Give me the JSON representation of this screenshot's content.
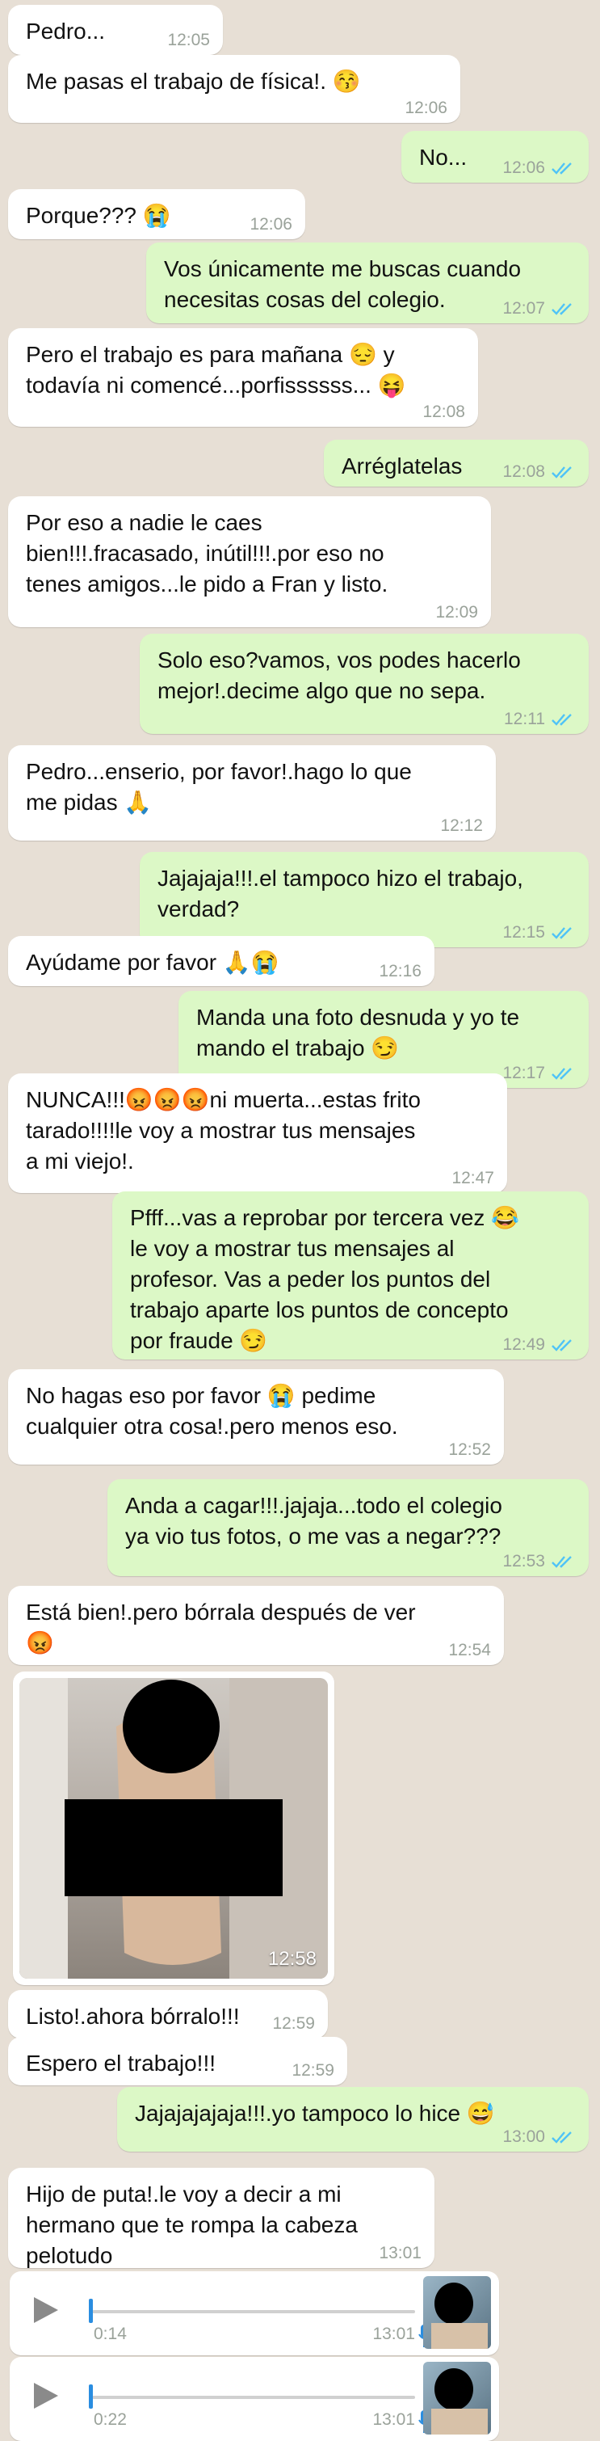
{
  "messages": [
    {
      "side": "in",
      "text": "Pedro...",
      "time": "12:05"
    },
    {
      "side": "in",
      "text": "Me pasas el trabajo de física!. 😚",
      "time": "12:06"
    },
    {
      "side": "out",
      "text": "No...",
      "time": "12:06"
    },
    {
      "side": "in",
      "text": "Porque??? 😭",
      "time": "12:06"
    },
    {
      "side": "out",
      "text": "Vos únicamente me buscas cuando\nnecesitas cosas del colegio.",
      "time": "12:07"
    },
    {
      "side": "in",
      "text": "Pero el trabajo es para mañana 😔 y\ntodavía ni comencé...porfissssss... 😝",
      "time": "12:08"
    },
    {
      "side": "out",
      "text": "Arréglatelas",
      "time": "12:08"
    },
    {
      "side": "in",
      "text": "Por eso a nadie le caes\nbien!!!.fracasado, inútil!!!.por eso no\ntenes amigos...le pido a Fran y listo.",
      "time": "12:09"
    },
    {
      "side": "out",
      "text": "Solo eso?vamos, vos podes hacerlo\nmejor!.decime algo que no sepa.",
      "time": "12:11"
    },
    {
      "side": "in",
      "text": "Pedro...enserio, por favor!.hago lo que\nme pidas 🙏",
      "time": "12:12"
    },
    {
      "side": "out",
      "text": "Jajajaja!!!.el tampoco hizo el trabajo,\nverdad?",
      "time": "12:15"
    },
    {
      "side": "in",
      "text": "Ayúdame por favor 🙏😭",
      "time": "12:16"
    },
    {
      "side": "out",
      "text": "Manda una foto desnuda y yo te\nmando el trabajo 😏",
      "time": "12:17"
    },
    {
      "side": "in",
      "text": "NUNCA!!!😡😡😡ni muerta...estas frito\ntarado!!!!le voy a mostrar tus mensajes\na mi viejo!.",
      "time": "12:47"
    },
    {
      "side": "out",
      "text": "Pfff...vas a reprobar por tercera vez 😂\nle voy a mostrar tus mensajes al\nprofesor. Vas a peder los puntos del\ntrabajo aparte los puntos de concepto\npor fraude 😏",
      "time": "12:49"
    },
    {
      "side": "in",
      "text": "No hagas eso por favor 😭 pedime\ncualquier otra cosa!.pero menos eso.",
      "time": "12:52"
    },
    {
      "side": "out",
      "text": "Anda a cagar!!!.jajaja...todo el colegio\nya vio tus fotos, o me vas a negar???",
      "time": "12:53"
    },
    {
      "side": "in",
      "text": "Está bien!.pero bórrala después de ver\n😡",
      "time": "12:54"
    },
    {
      "side": "in",
      "text": "Listo!.ahora bórralo!!!",
      "time": "12:59"
    },
    {
      "side": "in",
      "text": "Espero el trabajo!!!",
      "time": "12:59"
    },
    {
      "side": "out",
      "text": "Jajajajajaja!!!.yo tampoco lo hice 😅",
      "time": "13:00"
    },
    {
      "side": "in",
      "text": "Hijo de puta!.le voy a decir a mi\nhermano que te rompa la cabeza\npelotudo",
      "time": "13:01"
    }
  ],
  "photo": {
    "time": "12:58"
  },
  "voice_notes": [
    {
      "duration": "0:14",
      "time": "13:01"
    },
    {
      "duration": "0:22",
      "time": "13:01"
    }
  ],
  "colors": {
    "incoming": "#ffffff",
    "outgoing": "#dcf8c6",
    "read_ticks": "#4fc3f7",
    "timestamp": "#9aa29a"
  }
}
